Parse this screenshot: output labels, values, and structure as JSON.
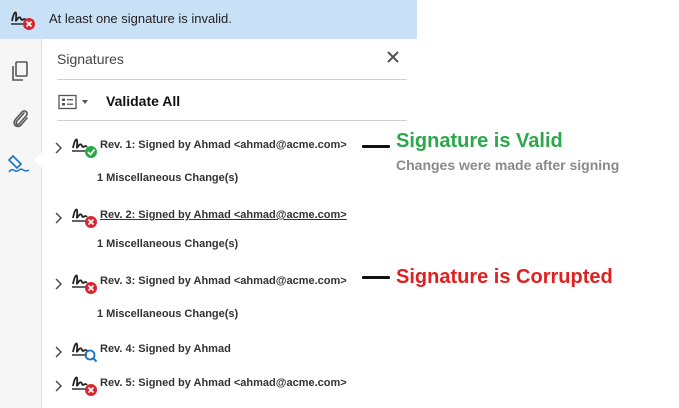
{
  "banner": {
    "text": "At least one signature is invalid.",
    "icon": "signature-invalid-icon"
  },
  "rail": {
    "items": [
      {
        "name": "page-thumbnails",
        "icon": "pages-icon"
      },
      {
        "name": "attachments",
        "icon": "paperclip-icon"
      },
      {
        "name": "signatures",
        "icon": "signature-pen-icon",
        "active": true
      }
    ]
  },
  "panel": {
    "title": "Signatures",
    "close_icon": "close-icon",
    "options_icon": "options-menu-icon",
    "validate_all": "Validate All"
  },
  "signatures": [
    {
      "label": "Rev. 1: Signed by Ahmad <ahmad@acme.com>",
      "status": "valid",
      "details": "1 Miscellaneous Change(s)"
    },
    {
      "label": "Rev. 2: Signed by Ahmad <ahmad@acme.com>",
      "status": "invalid",
      "details": "1 Miscellaneous Change(s)"
    },
    {
      "label": "Rev. 3: Signed by Ahmad <ahmad@acme.com>",
      "status": "invalid",
      "details": "1 Miscellaneous Change(s)"
    },
    {
      "label": "Rev. 4: Signed by Ahmad",
      "status": "unknown"
    },
    {
      "label": "Rev. 5: Signed by Ahmad <ahmad@acme.com>",
      "status": "invalid"
    }
  ],
  "annotations": {
    "valid_title": "Signature is Valid",
    "valid_note": "Changes were made after signing",
    "corrupted_title": "Signature is Corrupted"
  },
  "colors": {
    "valid": "#2aa84a",
    "invalid": "#d7262e",
    "unknown": "#1a73c8",
    "banner_bg": "#c9e1f6"
  }
}
